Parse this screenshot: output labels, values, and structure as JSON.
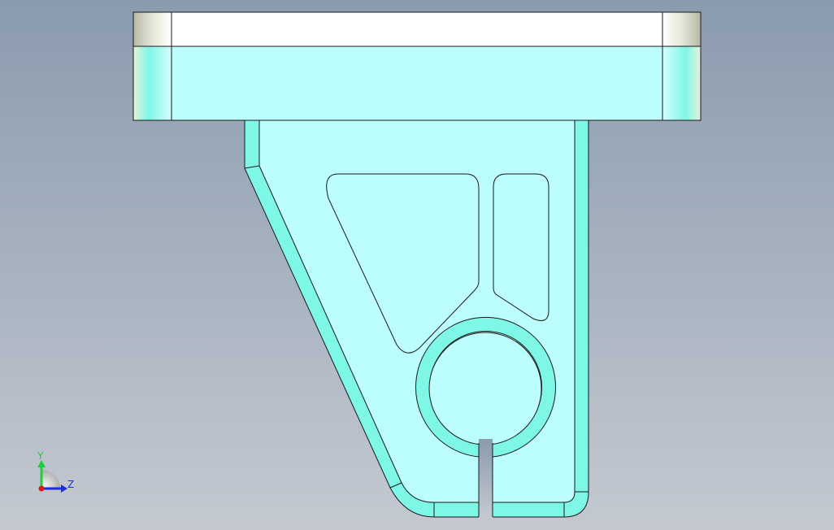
{
  "viewport": {
    "background_top": "#8a9bae",
    "background_bottom": "#c4c9d1",
    "part_fill": "#bcfdfd",
    "part_fill_shaded": "#7ef7e7",
    "part_edge": "#1a1a1a",
    "flange_top_fill": "#ffffff",
    "flange_side_fill": "#d2d4c6"
  },
  "triad": {
    "y_label": "Y",
    "z_label": "Z",
    "y_color": "#1fcf3a",
    "z_color": "#1c2fd6",
    "x_color": "#d61c1c"
  }
}
